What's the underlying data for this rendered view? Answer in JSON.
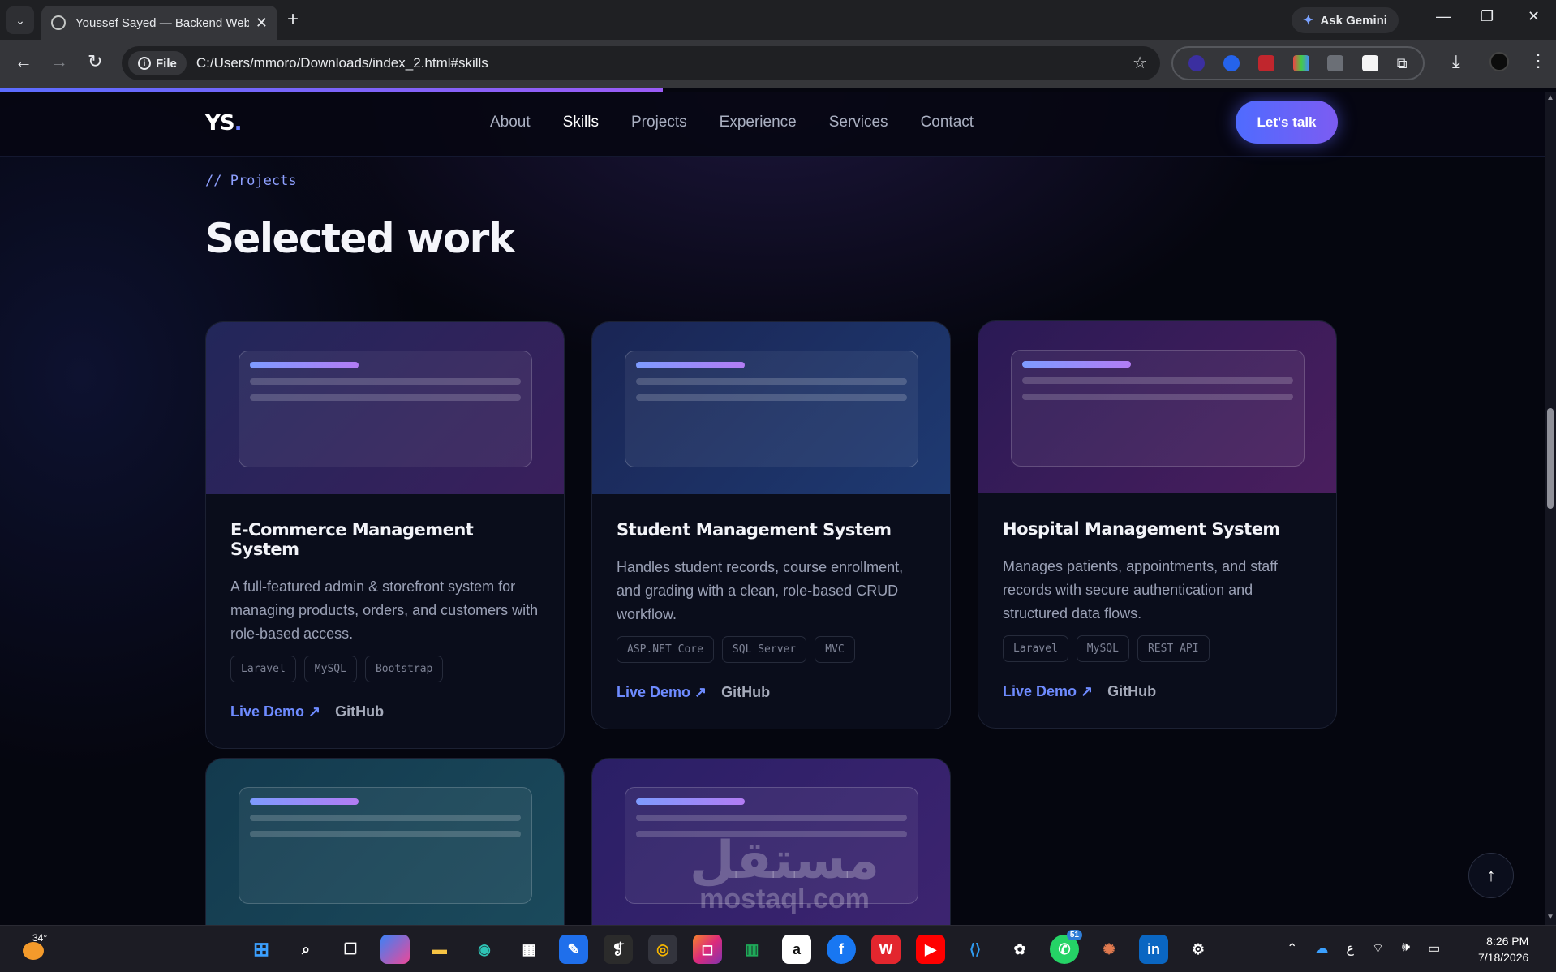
{
  "browser": {
    "tab_title": "Youssef Sayed — Backend Web",
    "gemini_label": "Ask Gemini",
    "file_chip": "File",
    "url": "C:/Users/mmoro/Downloads/index_2.html#skills"
  },
  "site": {
    "logo": "YS",
    "logo_dot": ".",
    "nav": [
      "About",
      "Skills",
      "Projects",
      "Experience",
      "Services",
      "Contact"
    ],
    "active_nav": "Skills",
    "cta": "Let's talk"
  },
  "section": {
    "eyebrow": "// Projects",
    "heading": "Selected work"
  },
  "projects": [
    {
      "title": "E-Commerce Management System",
      "description": "A full-featured admin & storefront system for managing products, orders, and customers with role-based access.",
      "tags": [
        "Laravel",
        "MySQL",
        "Bootstrap"
      ],
      "demo_label": "Live Demo ↗",
      "github_label": "GitHub",
      "gradient": [
        "#22275a",
        "#3a1f5c"
      ]
    },
    {
      "title": "Student Management System",
      "description": "Handles student records, course enrollment, and grading with a clean, role-based CRUD workflow.",
      "tags": [
        "ASP.NET Core",
        "SQL Server",
        "MVC"
      ],
      "demo_label": "Live Demo ↗",
      "github_label": "GitHub",
      "gradient": [
        "#1a2554",
        "#1e3a72"
      ]
    },
    {
      "title": "Hospital Management System",
      "description": "Manages patients, appointments, and staff records with secure authentication and structured data flows.",
      "tags": [
        "Laravel",
        "MySQL",
        "REST API"
      ],
      "demo_label": "Live Demo ↗",
      "github_label": "GitHub",
      "gradient": [
        "#2a1a55",
        "#4a1e5e"
      ]
    },
    {
      "gradient": [
        "#133a4e",
        "#1b4a5c"
      ]
    },
    {
      "gradient": [
        "#2a1f66",
        "#3d2470"
      ]
    }
  ],
  "watermark": {
    "arabic": "مستقل",
    "latin": "mostaql.com"
  },
  "taskbar": {
    "temperature": "34°",
    "apps": [
      "windows-start",
      "search",
      "task-view",
      "copilot",
      "file-explorer",
      "edge",
      "store",
      "notepad",
      "pdf-reader",
      "chrome",
      "instagram",
      "sheets",
      "amazon",
      "facebook",
      "wps",
      "youtube",
      "vscode",
      "chatgpt",
      "whatsapp",
      "claude",
      "linkedin",
      "settings"
    ],
    "whatsapp_badge": "51",
    "lang": "ع",
    "time": "8:26 PM",
    "date": "7/18/2026"
  },
  "colors": {
    "accent": "#6b7dff",
    "page_bg": "#05060f",
    "link": "#6e8bff"
  }
}
